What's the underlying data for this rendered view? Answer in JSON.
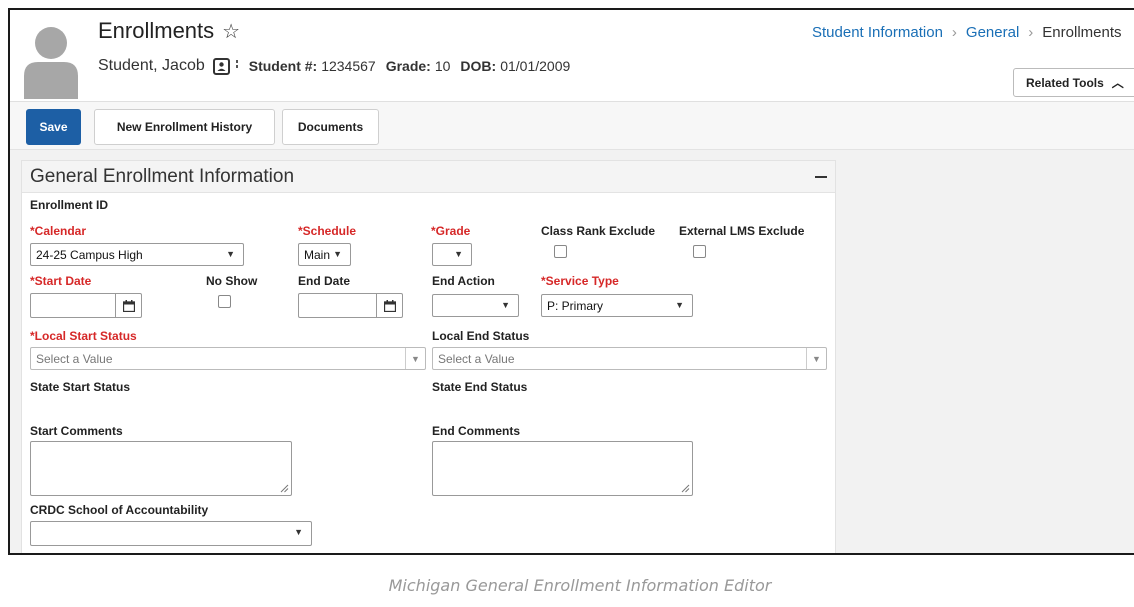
{
  "header": {
    "title": "Enrollments",
    "star_icon": "star-outline-icon",
    "student_name": "Student, Jacob",
    "student_number_label": "Student #:",
    "student_number": "1234567",
    "grade_label": "Grade:",
    "grade": "10",
    "dob_label": "DOB:",
    "dob": "01/01/2009",
    "breadcrumb": [
      "Student Information",
      "General",
      "Enrollments"
    ],
    "related_tools_label": "Related Tools",
    "related_tools_icon": "chevron-up-icon"
  },
  "toolbar": {
    "save_label": "Save",
    "new_enrollment_history_label": "New Enrollment History",
    "documents_label": "Documents",
    "save_color": "#1d5fa5"
  },
  "panel": {
    "title": "General Enrollment Information",
    "collapse_icon": "minus-icon",
    "enrollment_id_label": "Enrollment ID",
    "calendar_label": "Calendar",
    "calendar_value": "24-25 Campus High",
    "schedule_label": "Schedule",
    "schedule_value": "Main",
    "grade_label": "Grade",
    "grade_value": "",
    "class_rank_exclude_label": "Class Rank Exclude",
    "external_lms_exclude_label": "External LMS Exclude",
    "start_date_label": "Start Date",
    "start_date_value": "",
    "no_show_label": "No Show",
    "end_date_label": "End Date",
    "end_date_value": "",
    "end_action_label": "End Action",
    "end_action_value": "",
    "service_type_label": "Service Type",
    "service_type_value": "P: Primary",
    "local_start_status_label": "Local Start Status",
    "local_start_status_placeholder": "Select a Value",
    "local_end_status_label": "Local End Status",
    "local_end_status_placeholder": "Select a Value",
    "state_start_status_label": "State Start Status",
    "state_end_status_label": "State End Status",
    "start_comments_label": "Start Comments",
    "end_comments_label": "End Comments",
    "crdc_label": "CRDC School of Accountability",
    "crdc_value": "",
    "required_marker": "*",
    "required_color": "#d62828"
  },
  "caption": "Michigan General Enrollment Information Editor"
}
